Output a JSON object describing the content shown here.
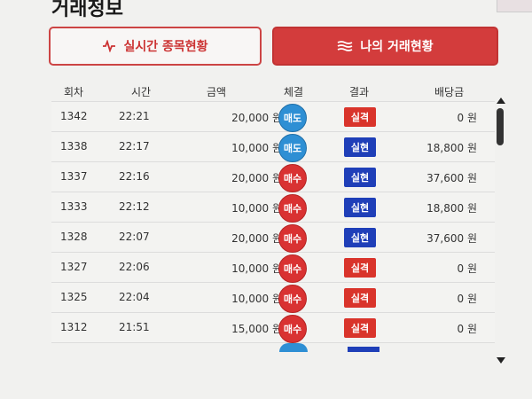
{
  "page": {
    "title": "거래정보"
  },
  "tabs": {
    "realtime": {
      "label": "실시간 종목현황",
      "icon": "pulse-wave-icon"
    },
    "history": {
      "label": "나의 거래현황",
      "icon": "stack-lines-icon"
    }
  },
  "table": {
    "headers": [
      "회차",
      "시간",
      "금액",
      "체결",
      "결과",
      "배당금"
    ],
    "rows": [
      {
        "round": "1342",
        "time": "22:21",
        "amount": "20,000 원",
        "exec": "매도",
        "result": "실격",
        "payout": "0 원"
      },
      {
        "round": "1338",
        "time": "22:17",
        "amount": "10,000 원",
        "exec": "매도",
        "result": "실현",
        "payout": "18,800 원"
      },
      {
        "round": "1337",
        "time": "22:16",
        "amount": "20,000 원",
        "exec": "매수",
        "result": "실현",
        "payout": "37,600 원"
      },
      {
        "round": "1333",
        "time": "22:12",
        "amount": "10,000 원",
        "exec": "매수",
        "result": "실현",
        "payout": "18,800 원"
      },
      {
        "round": "1328",
        "time": "22:07",
        "amount": "20,000 원",
        "exec": "매수",
        "result": "실현",
        "payout": "37,600 원"
      },
      {
        "round": "1327",
        "time": "22:06",
        "amount": "10,000 원",
        "exec": "매수",
        "result": "실격",
        "payout": "0 원"
      },
      {
        "round": "1325",
        "time": "22:04",
        "amount": "10,000 원",
        "exec": "매수",
        "result": "실격",
        "payout": "0 원"
      },
      {
        "round": "1312",
        "time": "21:51",
        "amount": "15,000 원",
        "exec": "매수",
        "result": "실격",
        "payout": "0 원"
      }
    ]
  },
  "colors": {
    "accent_red": "#d33c3c",
    "sell_blue": "#2e8fd4",
    "buy_red": "#d93232",
    "win_blue": "#1f3fb8",
    "fail_red": "#d9342b"
  }
}
